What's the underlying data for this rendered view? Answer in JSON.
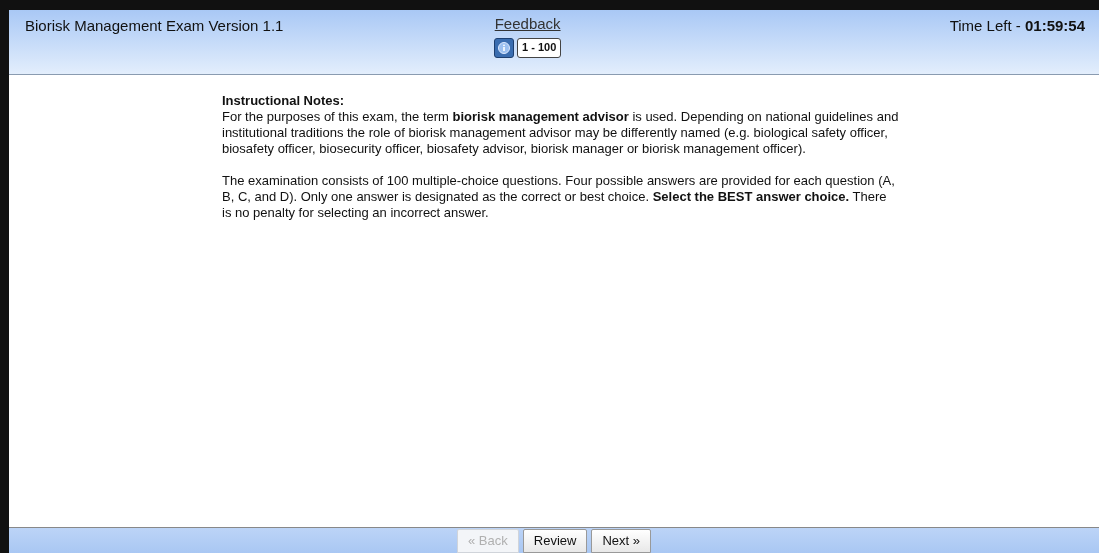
{
  "header": {
    "title": "Biorisk Management Exam Version 1.1",
    "feedback_link": "Feedback",
    "info_button": {
      "selected": true
    },
    "range_button": {
      "label": "1 - 100",
      "selected": false
    },
    "timer_label": "Time Left - ",
    "timer_value": "01:59:54"
  },
  "content": {
    "heading": "Instructional Notes:",
    "paragraphs": [
      "For the purposes of this exam, the term **biorisk management advisor** is used. Depending on national guidelines and institutional traditions the role of biorisk management advisor may be differently named (e.g. biological safety officer, biosafety officer, biosecurity officer, biosafety advisor, biorisk manager or biorisk management officer).",
      "The examination consists of 100 multiple-choice questions. Four possible answers are provided for each question (A, B, C, and D). Only one answer is designated as the correct or best choice. **Select the BEST answer choice.** There is no penalty for selecting an incorrect answer."
    ]
  },
  "footer": {
    "buttons": [
      {
        "label": "« Back",
        "disabled": true
      },
      {
        "label": "Review",
        "disabled": false
      },
      {
        "label": "Next »",
        "disabled": false
      }
    ]
  }
}
